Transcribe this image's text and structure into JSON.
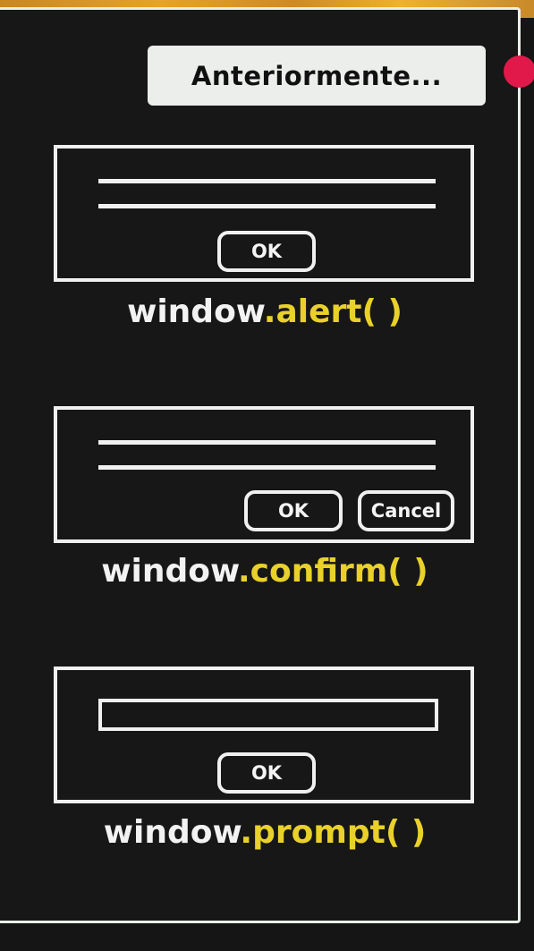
{
  "header": {
    "title": "Anteriormente..."
  },
  "colors": {
    "accent_yellow": "#e9d12a",
    "record_red": "#e0194a",
    "frame": "#e9efe6",
    "background": "#151515"
  },
  "alert": {
    "ok_label": "OK",
    "caption_object": "window",
    "caption_method": ".alert( )"
  },
  "confirm": {
    "ok_label": "OK",
    "cancel_label": "Cancel",
    "caption_object": "window",
    "caption_method": ".confirm( )"
  },
  "prompt": {
    "ok_label": "OK",
    "caption_object": "window",
    "caption_method": ".prompt( )",
    "input_value": ""
  }
}
